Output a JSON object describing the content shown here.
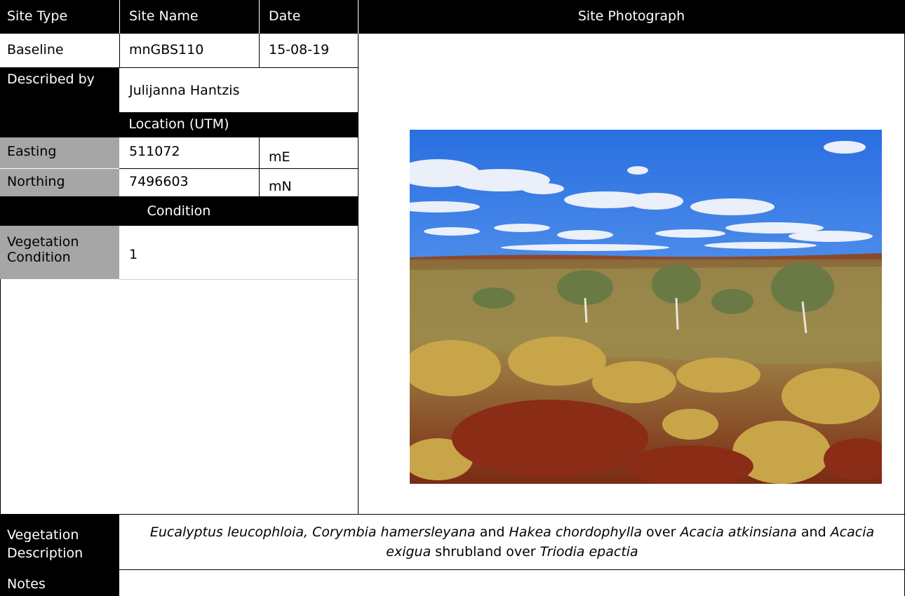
{
  "header": {
    "site_type_label": "Site Type",
    "site_name_label": "Site Name",
    "date_label": "Date",
    "photo_label": "Site Photograph"
  },
  "site": {
    "type": "Baseline",
    "name": "mnGBS110",
    "date": "15-08-19",
    "described_by_label": "Described by",
    "described_by": "Julijanna Hantzis"
  },
  "location": {
    "heading": "Location (UTM)",
    "easting_label": "Easting",
    "easting": "511072",
    "easting_unit": "mE",
    "northing_label": "Northing",
    "northing": "7496603",
    "northing_unit": "mN"
  },
  "condition": {
    "heading": "Condition",
    "veg_condition_label": "Vegetation Condition",
    "veg_condition": "1"
  },
  "vegetation": {
    "label": "Vegetation Description",
    "segments": [
      {
        "text": "Eucalyptus leucophloia, Corymbia hamersleyana",
        "italic": true
      },
      {
        "text": " and ",
        "italic": false
      },
      {
        "text": "Hakea chordophylla",
        "italic": true
      },
      {
        "text": " over ",
        "italic": false
      },
      {
        "text": "Acacia atkinsiana",
        "italic": true
      },
      {
        "text": " and ",
        "italic": false
      },
      {
        "text": "Acacia exigua",
        "italic": true
      },
      {
        "text": " shrubland over ",
        "italic": false
      },
      {
        "text": "Triodia epactia",
        "italic": true
      }
    ]
  },
  "notes": {
    "label": "Notes",
    "text": ""
  }
}
